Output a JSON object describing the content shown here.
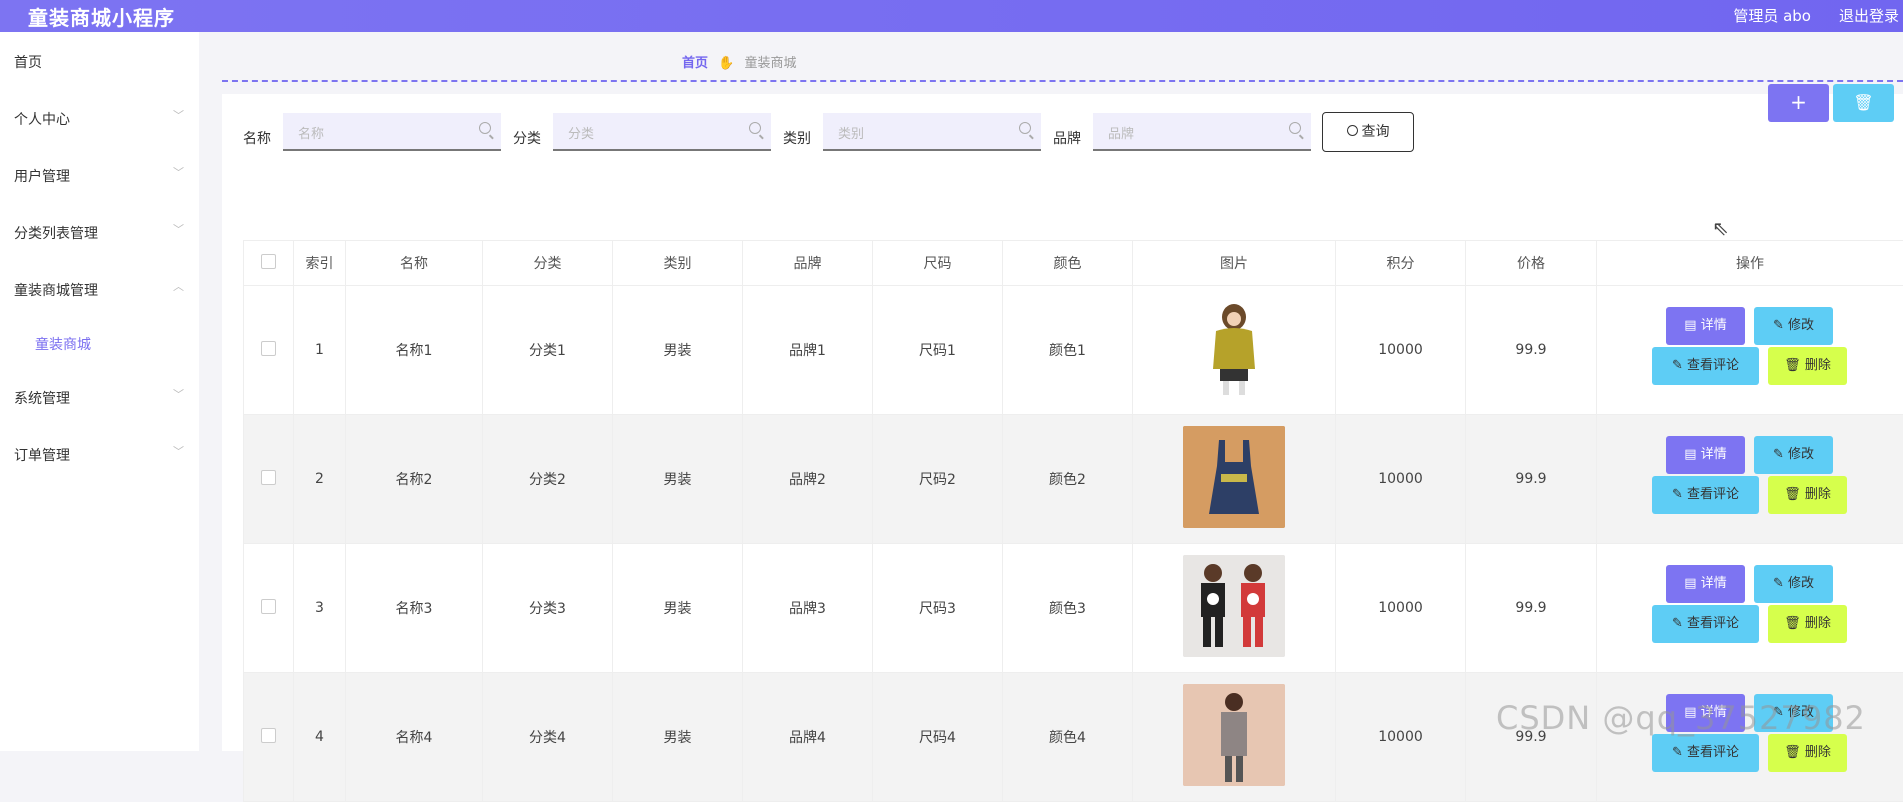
{
  "header": {
    "title": "童装商城小程序",
    "admin": "管理员 abo",
    "logout": "退出登录"
  },
  "sidebar": {
    "items": [
      {
        "label": "首页",
        "has_chevron": false
      },
      {
        "label": "个人中心",
        "has_chevron": true
      },
      {
        "label": "用户管理",
        "has_chevron": true
      },
      {
        "label": "分类列表管理",
        "has_chevron": true
      },
      {
        "label": "童装商城管理",
        "has_chevron": true,
        "expanded": true
      },
      {
        "label": "系统管理",
        "has_chevron": true
      },
      {
        "label": "订单管理",
        "has_chevron": true
      }
    ],
    "subitem": "童装商城"
  },
  "breadcrumb": {
    "home": "首页",
    "current": "童装商城"
  },
  "search": {
    "fields": [
      {
        "label": "名称",
        "placeholder": "名称"
      },
      {
        "label": "分类",
        "placeholder": "分类"
      },
      {
        "label": "类别",
        "placeholder": "类别"
      },
      {
        "label": "品牌",
        "placeholder": "品牌"
      }
    ],
    "button": "查询"
  },
  "toolbar": {
    "add_label": "+",
    "delete_icon": "trash-icon"
  },
  "table": {
    "columns": [
      "索引",
      "名称",
      "分类",
      "类别",
      "品牌",
      "尺码",
      "颜色",
      "图片",
      "积分",
      "价格",
      "操作"
    ],
    "rows": [
      {
        "index": "1",
        "name": "名称1",
        "category": "分类1",
        "type": "男装",
        "brand": "品牌1",
        "size": "尺码1",
        "color": "颜色1",
        "points": "10000",
        "price": "99.9"
      },
      {
        "index": "2",
        "name": "名称2",
        "category": "分类2",
        "type": "男装",
        "brand": "品牌2",
        "size": "尺码2",
        "color": "颜色2",
        "points": "10000",
        "price": "99.9"
      },
      {
        "index": "3",
        "name": "名称3",
        "category": "分类3",
        "type": "男装",
        "brand": "品牌3",
        "size": "尺码3",
        "color": "颜色3",
        "points": "10000",
        "price": "99.9"
      },
      {
        "index": "4",
        "name": "名称4",
        "category": "分类4",
        "type": "男装",
        "brand": "品牌4",
        "size": "尺码4",
        "color": "颜色4",
        "points": "10000",
        "price": "99.9"
      }
    ],
    "actions": {
      "detail": "详情",
      "edit": "修改",
      "review": "查看评论",
      "delete": "删除"
    }
  },
  "watermark": "CSDN @qq_37527982"
}
